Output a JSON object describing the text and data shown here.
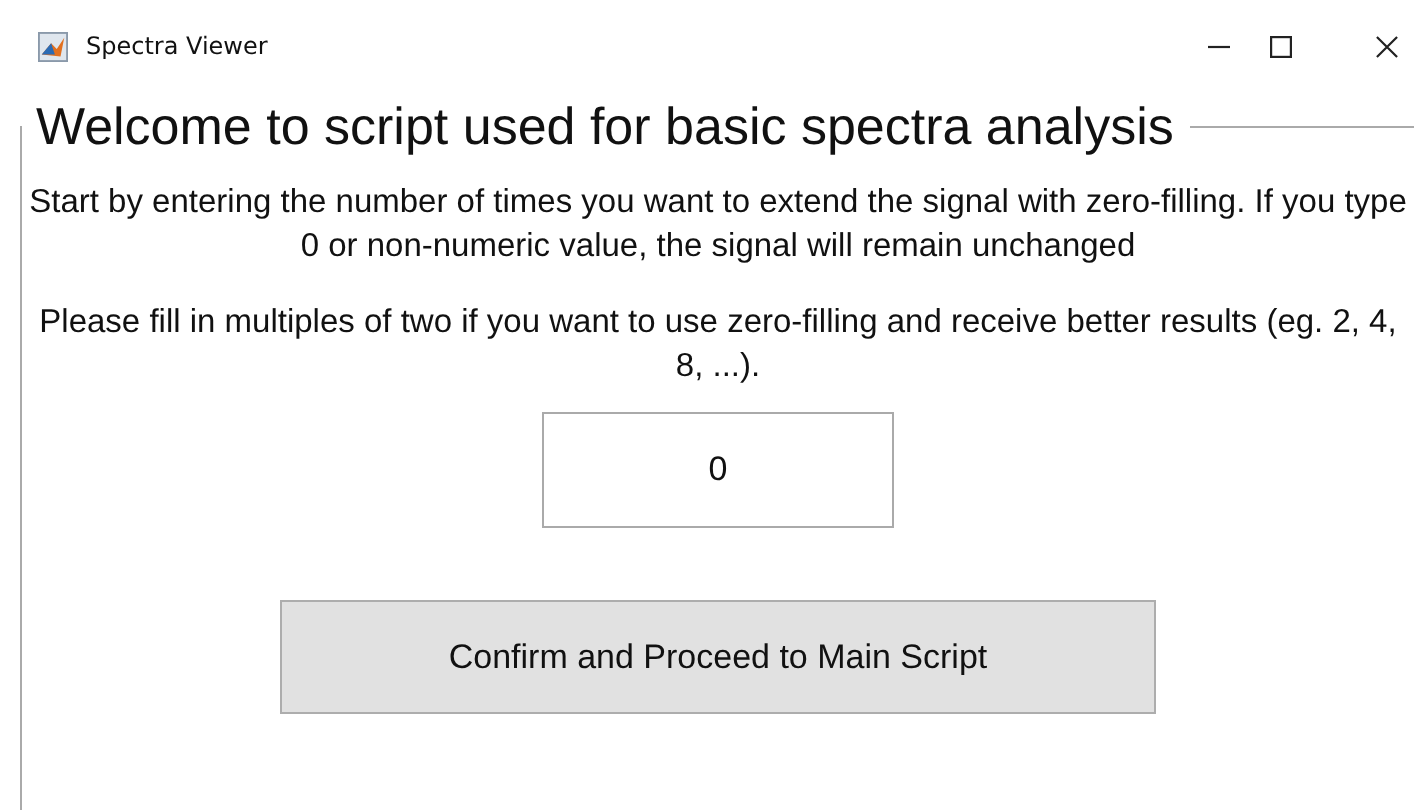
{
  "window": {
    "title": "Spectra Viewer"
  },
  "panel": {
    "title": "Welcome to script used for basic spectra analysis",
    "paragraphs": [
      "Start by entering the number of times you want to extend the signal with zero-filling. If you type 0 or non-numeric value, the signal will remain unchanged",
      "Please fill in multiples of two if you want to use zero-filling and receive better results (eg. 2, 4, 8, ...)."
    ],
    "input": {
      "value": "0"
    },
    "button": "Confirm and Proceed to Main Script"
  }
}
